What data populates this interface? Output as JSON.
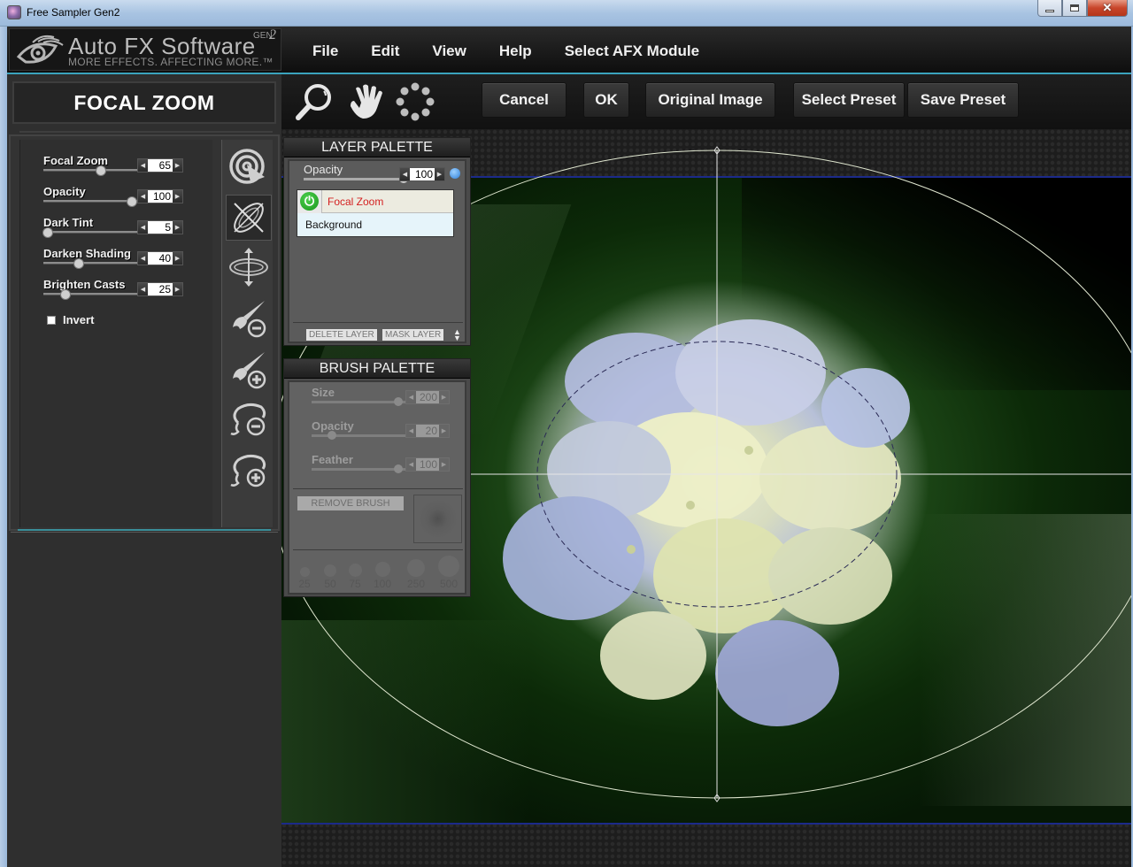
{
  "window": {
    "title": "Free Sampler Gen2",
    "controls": {
      "minimize": "minimize",
      "maximize": "maximize",
      "close": "close"
    }
  },
  "logo": {
    "brand": "Auto FX Software",
    "tagline": "MORE EFFECTS. AFFECTING MORE.™",
    "gen_label": "GEN",
    "gen_number": "2"
  },
  "menu": {
    "items": [
      {
        "label": "File"
      },
      {
        "label": "Edit"
      },
      {
        "label": "View"
      },
      {
        "label": "Help"
      },
      {
        "label": "Select AFX Module"
      }
    ]
  },
  "toolbar": {
    "tools": [
      {
        "icon": "zoom-magnifier-icon"
      },
      {
        "icon": "hand-pan-icon"
      },
      {
        "icon": "dot-ring-icon"
      }
    ],
    "buttons": {
      "cancel": "Cancel",
      "ok": "OK",
      "original": "Original Image",
      "select_preset": "Select Preset",
      "save_preset": "Save Preset"
    }
  },
  "effect_panel": {
    "title": "FOCAL ZOOM",
    "sliders": [
      {
        "label": "Focal Zoom",
        "value": "65",
        "position": 0.65
      },
      {
        "label": "Opacity",
        "value": "100",
        "position": 1.0
      },
      {
        "label": "Dark Tint",
        "value": "5",
        "position": 0.05
      },
      {
        "label": "Darken Shading",
        "value": "40",
        "position": 0.4
      },
      {
        "label": "Brighten Casts",
        "value": "25",
        "position": 0.25
      }
    ],
    "invert": {
      "label": "Invert",
      "checked": false
    },
    "tools": [
      {
        "icon": "target-pointer-icon",
        "active": false
      },
      {
        "icon": "crossed-ellipse-icon",
        "active": true
      },
      {
        "icon": "orbit-move-icon",
        "active": false
      },
      {
        "icon": "brush-minus-icon",
        "active": false
      },
      {
        "icon": "brush-plus-icon",
        "active": false
      },
      {
        "icon": "lasso-minus-icon",
        "active": false
      },
      {
        "icon": "lasso-plus-icon",
        "active": false
      }
    ]
  },
  "layer_palette": {
    "title": "LAYER PALETTE",
    "opacity": {
      "label": "Opacity",
      "value": "100",
      "position": 1.0
    },
    "layers": [
      {
        "name": "Focal Zoom",
        "visible": true,
        "selected": true
      },
      {
        "name": "Background"
      }
    ],
    "delete_label": "DELETE LAYER",
    "mask_label": "MASK LAYER"
  },
  "brush_palette": {
    "title": "BRUSH PALETTE",
    "sliders": [
      {
        "label": "Size",
        "value": "200",
        "position": 0.95
      },
      {
        "label": "Opacity",
        "value": "20",
        "position": 0.2
      },
      {
        "label": "Feather",
        "value": "100",
        "position": 0.95
      }
    ],
    "remove_label": "REMOVE BRUSH",
    "presets": [
      "25",
      "50",
      "75",
      "100",
      "250",
      "500"
    ]
  },
  "colors": {
    "accent_teal": "#3aa3bd",
    "layer_active_text": "#d42020",
    "power_green": "#18941a"
  }
}
